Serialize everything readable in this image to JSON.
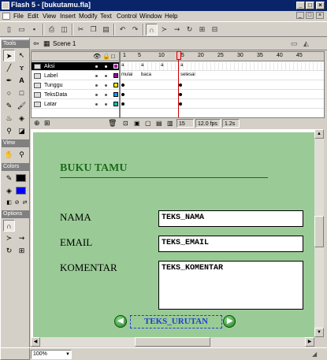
{
  "window": {
    "title": "Flash 5 - [bukutamu.fla]"
  },
  "menu": [
    "File",
    "Edit",
    "View",
    "Insert",
    "Modify",
    "Text",
    "Control",
    "Window",
    "Help"
  ],
  "panels": {
    "tools": "Tools",
    "view": "View",
    "colors": "Colors",
    "options": "Options"
  },
  "scene": "Scene 1",
  "layers": [
    {
      "name": "Aksi",
      "selected": true,
      "color": "#a000a0"
    },
    {
      "name": "Label",
      "selected": false,
      "color": "#a000a0"
    },
    {
      "name": "Tunggu",
      "selected": false,
      "color": "#ffff00"
    },
    {
      "name": "TeksData",
      "selected": false,
      "color": "#00a0ff"
    },
    {
      "name": "Latar",
      "selected": false,
      "color": "#00c0c0"
    }
  ],
  "frame_numbers": [
    "1",
    "5",
    "10",
    "15",
    "20",
    "25",
    "30",
    "35",
    "40",
    "45"
  ],
  "frame_labels": {
    "mulai": "mulai",
    "baca": "baca",
    "selesai": "selesai"
  },
  "timeline_status": {
    "frame": "15",
    "fps": "12.0 fps",
    "time": "1.2s"
  },
  "zoom": "100%",
  "form": {
    "title": "BUKU TAMU",
    "nama_label": "NAMA",
    "nama_value": "TEKS_NAMA",
    "email_label": "EMAIL",
    "email_value": "TEKS_EMAIL",
    "komentar_label": "KOMENTAR",
    "komentar_value": "TEKS_KOMENTAR",
    "urutan_value": "TEKS_URUTAN"
  },
  "colors": {
    "titlebar": "#0a246a",
    "stage": "#9acb96",
    "form_title": "#1c6b1c",
    "urutan_text": "#2040d0",
    "stroke": "#000000",
    "fill": "#0000ff"
  }
}
